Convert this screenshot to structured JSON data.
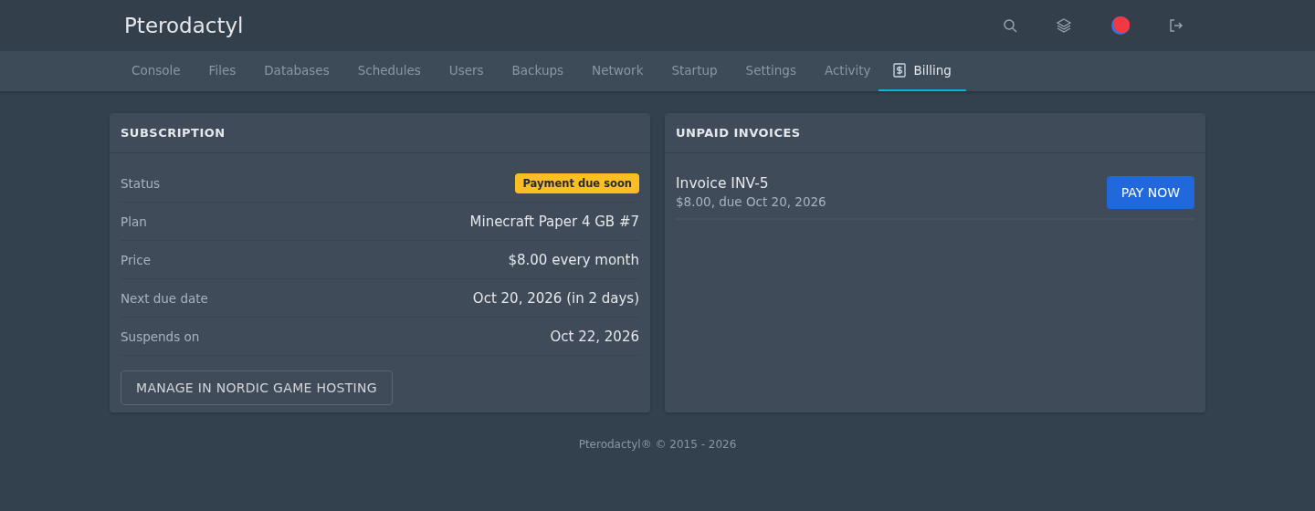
{
  "header": {
    "logo": "Pterodactyl"
  },
  "tabs": [
    {
      "label": "Console",
      "selected": false,
      "kind": "plain"
    },
    {
      "label": "Files",
      "selected": false,
      "kind": "plain"
    },
    {
      "label": "Databases",
      "selected": false,
      "kind": "plain"
    },
    {
      "label": "Schedules",
      "selected": false,
      "kind": "plain"
    },
    {
      "label": "Users",
      "selected": false,
      "kind": "plain"
    },
    {
      "label": "Backups",
      "selected": false,
      "kind": "plain"
    },
    {
      "label": "Network",
      "selected": false,
      "kind": "plain"
    },
    {
      "label": "Startup",
      "selected": false,
      "kind": "plain"
    },
    {
      "label": "Settings",
      "selected": false,
      "kind": "plain"
    },
    {
      "label": "Activity",
      "selected": false,
      "kind": "plain"
    },
    {
      "label": "Billing",
      "selected": true,
      "kind": "icon"
    }
  ],
  "subscription": {
    "title": "SUBSCRIPTION",
    "rows": [
      {
        "label": "Status",
        "value": "Payment due soon",
        "kind": "badge"
      },
      {
        "label": "Plan",
        "value": "Minecraft Paper 4 GB #7",
        "kind": "text"
      },
      {
        "label": "Price",
        "value": "$8.00 every month",
        "kind": "text"
      },
      {
        "label": "Next due date",
        "value": "Oct 20, 2026 (in 2 days)",
        "kind": "text"
      },
      {
        "label": "Suspends on",
        "value": "Oct 22, 2026",
        "kind": "text"
      }
    ],
    "button": "MANAGE IN NORDIC GAME HOSTING"
  },
  "unpaid_invoices": {
    "title": "UNPAID INVOICES",
    "invoices": [
      {
        "name": "Invoice INV-5",
        "detail": "$8.00, due Oct 20, 2026",
        "button": "PAY NOW"
      }
    ]
  },
  "footer": "Pterodactyl® © 2015 - 2026"
}
